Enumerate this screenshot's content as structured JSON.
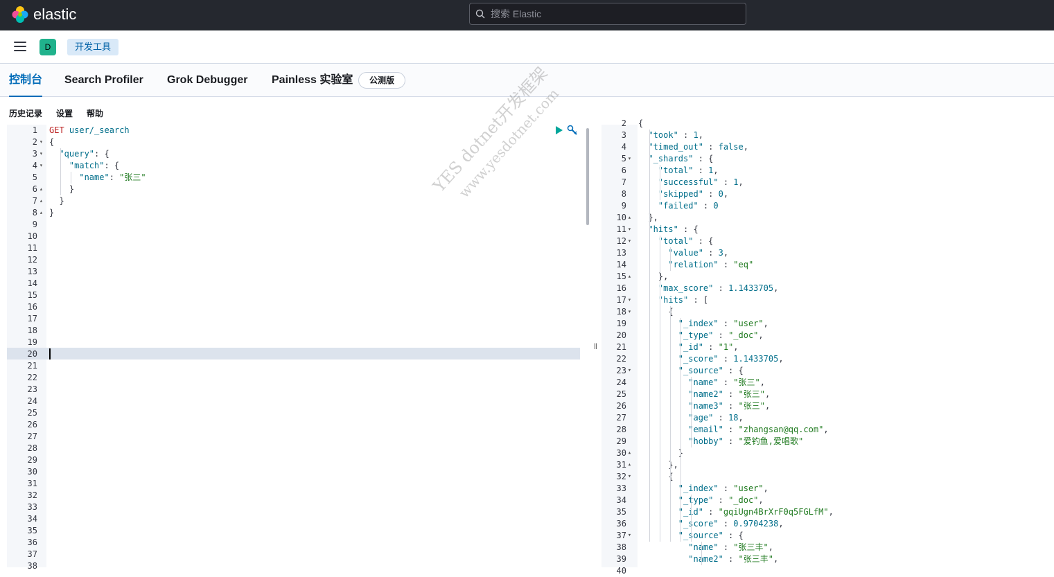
{
  "header": {
    "brand": "elastic",
    "search_placeholder": "搜索 Elastic"
  },
  "navbar": {
    "avatar_letter": "D",
    "breadcrumb": "开发工具"
  },
  "tabs": [
    {
      "label": "控制台",
      "active": true
    },
    {
      "label": "Search Profiler",
      "active": false
    },
    {
      "label": "Grok Debugger",
      "active": false
    },
    {
      "label": "Painless 实验室",
      "active": false
    }
  ],
  "beta_badge": "公测版",
  "subnav": {
    "history": "历史记录",
    "settings": "设置",
    "help": "帮助"
  },
  "request_editor": {
    "line_count": 38,
    "active_line": 20,
    "lines": [
      [
        {
          "t": "GET",
          "c": "kw"
        },
        {
          "t": " user/_search",
          "c": "str"
        }
      ],
      [
        {
          "t": "{",
          "c": ""
        }
      ],
      [
        {
          "t": "  \"query\"",
          "c": "str"
        },
        {
          "t": ": {",
          "c": ""
        }
      ],
      [
        {
          "t": "    \"match\"",
          "c": "str"
        },
        {
          "t": ": {",
          "c": ""
        }
      ],
      [
        {
          "t": "      \"name\"",
          "c": "str"
        },
        {
          "t": ": ",
          "c": ""
        },
        {
          "t": "\"张三\"",
          "c": "val"
        }
      ],
      [
        {
          "t": "    }",
          "c": ""
        }
      ],
      [
        {
          "t": "  }",
          "c": ""
        }
      ],
      [
        {
          "t": "}",
          "c": ""
        }
      ]
    ]
  },
  "response_editor": {
    "first_line": 2,
    "lines": [
      [
        {
          "t": "{",
          "c": ""
        }
      ],
      [
        {
          "t": "  \"took\"",
          "c": "str"
        },
        {
          "t": " : ",
          "c": ""
        },
        {
          "t": "1",
          "c": "num"
        },
        {
          "t": ",",
          "c": ""
        }
      ],
      [
        {
          "t": "  \"timed_out\"",
          "c": "str"
        },
        {
          "t": " : ",
          "c": ""
        },
        {
          "t": "false",
          "c": "bool"
        },
        {
          "t": ",",
          "c": ""
        }
      ],
      [
        {
          "t": "  \"_shards\"",
          "c": "str"
        },
        {
          "t": " : {",
          "c": ""
        }
      ],
      [
        {
          "t": "    \"total\"",
          "c": "str"
        },
        {
          "t": " : ",
          "c": ""
        },
        {
          "t": "1",
          "c": "num"
        },
        {
          "t": ",",
          "c": ""
        }
      ],
      [
        {
          "t": "    \"successful\"",
          "c": "str"
        },
        {
          "t": " : ",
          "c": ""
        },
        {
          "t": "1",
          "c": "num"
        },
        {
          "t": ",",
          "c": ""
        }
      ],
      [
        {
          "t": "    \"skipped\"",
          "c": "str"
        },
        {
          "t": " : ",
          "c": ""
        },
        {
          "t": "0",
          "c": "num"
        },
        {
          "t": ",",
          "c": ""
        }
      ],
      [
        {
          "t": "    \"failed\"",
          "c": "str"
        },
        {
          "t": " : ",
          "c": ""
        },
        {
          "t": "0",
          "c": "num"
        }
      ],
      [
        {
          "t": "  },",
          "c": ""
        }
      ],
      [
        {
          "t": "  \"hits\"",
          "c": "str"
        },
        {
          "t": " : {",
          "c": ""
        }
      ],
      [
        {
          "t": "    \"total\"",
          "c": "str"
        },
        {
          "t": " : {",
          "c": ""
        }
      ],
      [
        {
          "t": "      \"value\"",
          "c": "str"
        },
        {
          "t": " : ",
          "c": ""
        },
        {
          "t": "3",
          "c": "num"
        },
        {
          "t": ",",
          "c": ""
        }
      ],
      [
        {
          "t": "      \"relation\"",
          "c": "str"
        },
        {
          "t": " : ",
          "c": ""
        },
        {
          "t": "\"eq\"",
          "c": "val"
        }
      ],
      [
        {
          "t": "    },",
          "c": ""
        }
      ],
      [
        {
          "t": "    \"max_score\"",
          "c": "str"
        },
        {
          "t": " : ",
          "c": ""
        },
        {
          "t": "1.1433705",
          "c": "num"
        },
        {
          "t": ",",
          "c": ""
        }
      ],
      [
        {
          "t": "    \"hits\"",
          "c": "str"
        },
        {
          "t": " : [",
          "c": ""
        }
      ],
      [
        {
          "t": "      {",
          "c": ""
        }
      ],
      [
        {
          "t": "        \"_index\"",
          "c": "str"
        },
        {
          "t": " : ",
          "c": ""
        },
        {
          "t": "\"user\"",
          "c": "val"
        },
        {
          "t": ",",
          "c": ""
        }
      ],
      [
        {
          "t": "        \"_type\"",
          "c": "str"
        },
        {
          "t": " : ",
          "c": ""
        },
        {
          "t": "\"_doc\"",
          "c": "val"
        },
        {
          "t": ",",
          "c": ""
        }
      ],
      [
        {
          "t": "        \"_id\"",
          "c": "str"
        },
        {
          "t": " : ",
          "c": ""
        },
        {
          "t": "\"1\"",
          "c": "val"
        },
        {
          "t": ",",
          "c": ""
        }
      ],
      [
        {
          "t": "        \"_score\"",
          "c": "str"
        },
        {
          "t": " : ",
          "c": ""
        },
        {
          "t": "1.1433705",
          "c": "num"
        },
        {
          "t": ",",
          "c": ""
        }
      ],
      [
        {
          "t": "        \"_source\"",
          "c": "str"
        },
        {
          "t": " : {",
          "c": ""
        }
      ],
      [
        {
          "t": "          \"name\"",
          "c": "str"
        },
        {
          "t": " : ",
          "c": ""
        },
        {
          "t": "\"张三\"",
          "c": "val"
        },
        {
          "t": ",",
          "c": ""
        }
      ],
      [
        {
          "t": "          \"name2\"",
          "c": "str"
        },
        {
          "t": " : ",
          "c": ""
        },
        {
          "t": "\"张三\"",
          "c": "val"
        },
        {
          "t": ",",
          "c": ""
        }
      ],
      [
        {
          "t": "          \"name3\"",
          "c": "str"
        },
        {
          "t": " : ",
          "c": ""
        },
        {
          "t": "\"张三\"",
          "c": "val"
        },
        {
          "t": ",",
          "c": ""
        }
      ],
      [
        {
          "t": "          \"age\"",
          "c": "str"
        },
        {
          "t": " : ",
          "c": ""
        },
        {
          "t": "18",
          "c": "num"
        },
        {
          "t": ",",
          "c": ""
        }
      ],
      [
        {
          "t": "          \"email\"",
          "c": "str"
        },
        {
          "t": " : ",
          "c": ""
        },
        {
          "t": "\"zhangsan@qq.com\"",
          "c": "val"
        },
        {
          "t": ",",
          "c": ""
        }
      ],
      [
        {
          "t": "          \"hobby\"",
          "c": "str"
        },
        {
          "t": " : ",
          "c": ""
        },
        {
          "t": "\"爱钓鱼,爱唱歌\"",
          "c": "val"
        }
      ],
      [
        {
          "t": "        }",
          "c": ""
        }
      ],
      [
        {
          "t": "      },",
          "c": ""
        }
      ],
      [
        {
          "t": "      {",
          "c": ""
        }
      ],
      [
        {
          "t": "        \"_index\"",
          "c": "str"
        },
        {
          "t": " : ",
          "c": ""
        },
        {
          "t": "\"user\"",
          "c": "val"
        },
        {
          "t": ",",
          "c": ""
        }
      ],
      [
        {
          "t": "        \"_type\"",
          "c": "str"
        },
        {
          "t": " : ",
          "c": ""
        },
        {
          "t": "\"_doc\"",
          "c": "val"
        },
        {
          "t": ",",
          "c": ""
        }
      ],
      [
        {
          "t": "        \"_id\"",
          "c": "str"
        },
        {
          "t": " : ",
          "c": ""
        },
        {
          "t": "\"gqiUgn4BrXrF0q5FGLfM\"",
          "c": "val"
        },
        {
          "t": ",",
          "c": ""
        }
      ],
      [
        {
          "t": "        \"_score\"",
          "c": "str"
        },
        {
          "t": " : ",
          "c": ""
        },
        {
          "t": "0.9704238",
          "c": "num"
        },
        {
          "t": ",",
          "c": ""
        }
      ],
      [
        {
          "t": "        \"_source\"",
          "c": "str"
        },
        {
          "t": " : {",
          "c": ""
        }
      ],
      [
        {
          "t": "          \"name\"",
          "c": "str"
        },
        {
          "t": " : ",
          "c": ""
        },
        {
          "t": "\"张三丰\"",
          "c": "val"
        },
        {
          "t": ",",
          "c": ""
        }
      ],
      [
        {
          "t": "          \"name2\"",
          "c": "str"
        },
        {
          "t": " : ",
          "c": ""
        },
        {
          "t": "\"张三丰\"",
          "c": "val"
        },
        {
          "t": ",",
          "c": ""
        }
      ]
    ]
  },
  "watermark": {
    "line1": "YES dotnet开发框架",
    "line2": "www.yesdotnet.com"
  },
  "colors": {
    "accent": "#006bb8",
    "topbar": "#25282f",
    "run": "#00a69b"
  }
}
